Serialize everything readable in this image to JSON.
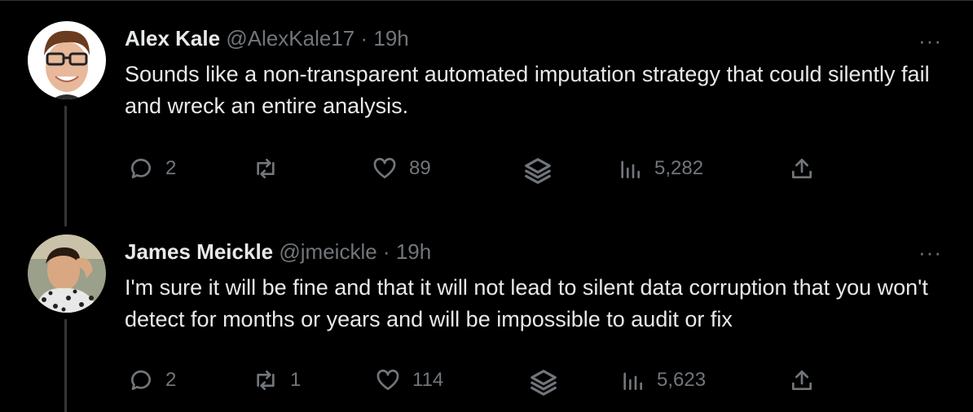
{
  "tweets": [
    {
      "name": "Alex Kale",
      "handle": "@AlexKale17",
      "separator": "·",
      "time": "19h",
      "text": "Sounds like a non-transparent automated imputation strategy that could silently fail and wreck an entire analysis.",
      "more": "···",
      "replies": "2",
      "retweets": "",
      "likes": "89",
      "views": "5,282"
    },
    {
      "name": "James Meickle",
      "handle": "@jmeickle",
      "separator": "·",
      "time": "19h",
      "text": "I'm sure it will be fine and that it will not lead to silent data corruption that you won't detect for months or years and will be impossible to audit or fix",
      "more": "···",
      "replies": "2",
      "retweets": "1",
      "likes": "114",
      "views": "5,623"
    }
  ],
  "icons": {
    "reply": "speech-bubble-icon",
    "retweet": "retweet-arrows-icon",
    "like": "heart-icon",
    "stack": "layers-icon",
    "views": "bar-chart-icon",
    "share": "share-upload-icon"
  },
  "colors": {
    "background": "#000000",
    "text": "#e7e9ea",
    "muted": "#71767b",
    "thread_line": "#333639"
  }
}
